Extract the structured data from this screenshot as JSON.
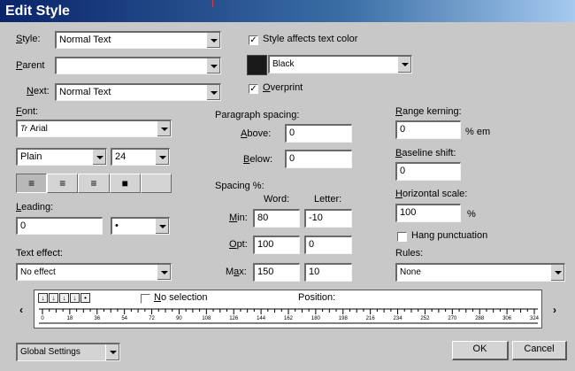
{
  "window": {
    "title": "Edit Style"
  },
  "left": {
    "style": {
      "label": "Style:",
      "value": "Normal Text"
    },
    "parent": {
      "label": "Parent",
      "value": ""
    },
    "next": {
      "label": "Next:",
      "value": "Normal Text"
    },
    "font": {
      "label": "Font:",
      "value": "Arial",
      "icon": "truetype-font-icon"
    },
    "font_style": {
      "value": "Plain"
    },
    "font_size": {
      "value": "24"
    },
    "leading": {
      "label": "Leading:",
      "value": "0",
      "unit": "•"
    },
    "text_effect": {
      "label": "Text effect:",
      "value": "No effect"
    },
    "alignment_buttons": [
      {
        "name": "align-left",
        "glyph": "≡"
      },
      {
        "name": "align-center",
        "glyph": "≡"
      },
      {
        "name": "align-right",
        "glyph": "≡"
      },
      {
        "name": "align-justify",
        "glyph": "■"
      },
      {
        "name": "align-none",
        "glyph": ""
      }
    ]
  },
  "middle": {
    "style_affects_color": {
      "label": "Style affects text color",
      "checked": true
    },
    "color": {
      "value": "Black"
    },
    "overprint": {
      "label": "Overprint",
      "checked": true
    },
    "paragraph_spacing": {
      "label": "Paragraph spacing:",
      "above_label": "Above:",
      "above": "0",
      "below_label": "Below:",
      "below": "0"
    },
    "spacing": {
      "label": "Spacing %:",
      "word_label": "Word:",
      "letter_label": "Letter:",
      "min_label": "Min:",
      "min_word": "80",
      "min_letter": "-10",
      "opt_label": "Opt:",
      "opt_word": "100",
      "opt_letter": "0",
      "max_label": "Max:",
      "max_word": "150",
      "max_letter": "10"
    }
  },
  "right": {
    "range_kerning": {
      "label": "Range kerning:",
      "value": "0",
      "unit": "% em"
    },
    "baseline_shift": {
      "label": "Baseline shift:",
      "value": "0"
    },
    "horizontal_scale": {
      "label": "Horizontal scale:",
      "value": "100",
      "unit": "%"
    },
    "hang_punctuation": {
      "label": "Hang punctuation",
      "checked": false
    },
    "rules": {
      "label": "Rules:",
      "value": "None"
    }
  },
  "tabs": {
    "no_selection": {
      "label": "No selection",
      "checked": false
    },
    "position_label": "Position:",
    "tab_types": [
      "↓",
      "↓",
      "↓",
      "↓",
      "•"
    ],
    "ruler_numbers": [
      "0",
      "18",
      "36",
      "54",
      "72",
      "90",
      "108",
      "126",
      "144",
      "162",
      "180",
      "198",
      "216",
      "234",
      "252",
      "270",
      "288",
      "306",
      "324"
    ]
  },
  "footer": {
    "global_settings": "Global Settings",
    "ok": "OK",
    "cancel": "Cancel"
  },
  "colors": {
    "title_bar": "#0a246a",
    "dialog": "#c8c8c8"
  }
}
